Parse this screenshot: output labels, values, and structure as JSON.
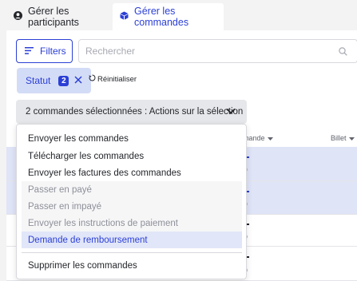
{
  "tabs": [
    {
      "label": "Gérer les participants",
      "icon": "user-circle-icon",
      "active": false
    },
    {
      "label": "Gérer les commandes",
      "icon": "cube-icon",
      "active": true
    }
  ],
  "toolbar": {
    "filters_label": "Filters",
    "search_placeholder": "Rechercher",
    "search_value": ""
  },
  "active_filter": {
    "label": "Statut",
    "count": "2",
    "reset_label": "Réinitialiser"
  },
  "selection_action": {
    "label": "2 commandes sélectionnées : Actions sur la sélection"
  },
  "table": {
    "columns": [
      "mande",
      "Billet"
    ]
  },
  "menu": {
    "items": [
      {
        "label": "Envoyer les commandes",
        "state": "enabled"
      },
      {
        "label": "Télécharger les commandes",
        "state": "enabled"
      },
      {
        "label": "Envoyer les factures des commandes",
        "state": "enabled"
      },
      {
        "label": "Passer en payé",
        "state": "disabled"
      },
      {
        "label": "Passer en impayé",
        "state": "disabled"
      },
      {
        "label": "Envoyer les instructions de paiement",
        "state": "disabled"
      },
      {
        "label": "Demande de remboursement",
        "state": "highlighted"
      },
      {
        "label": "Supprimer les commandes",
        "state": "enabled"
      }
    ]
  },
  "colors": {
    "accent": "#2b3fd6",
    "selected_row": "#dfe4f7",
    "chip_bg": "#d3dcf6",
    "action_bg": "#e6e7ea",
    "page_bg": "#f3f3f4"
  }
}
